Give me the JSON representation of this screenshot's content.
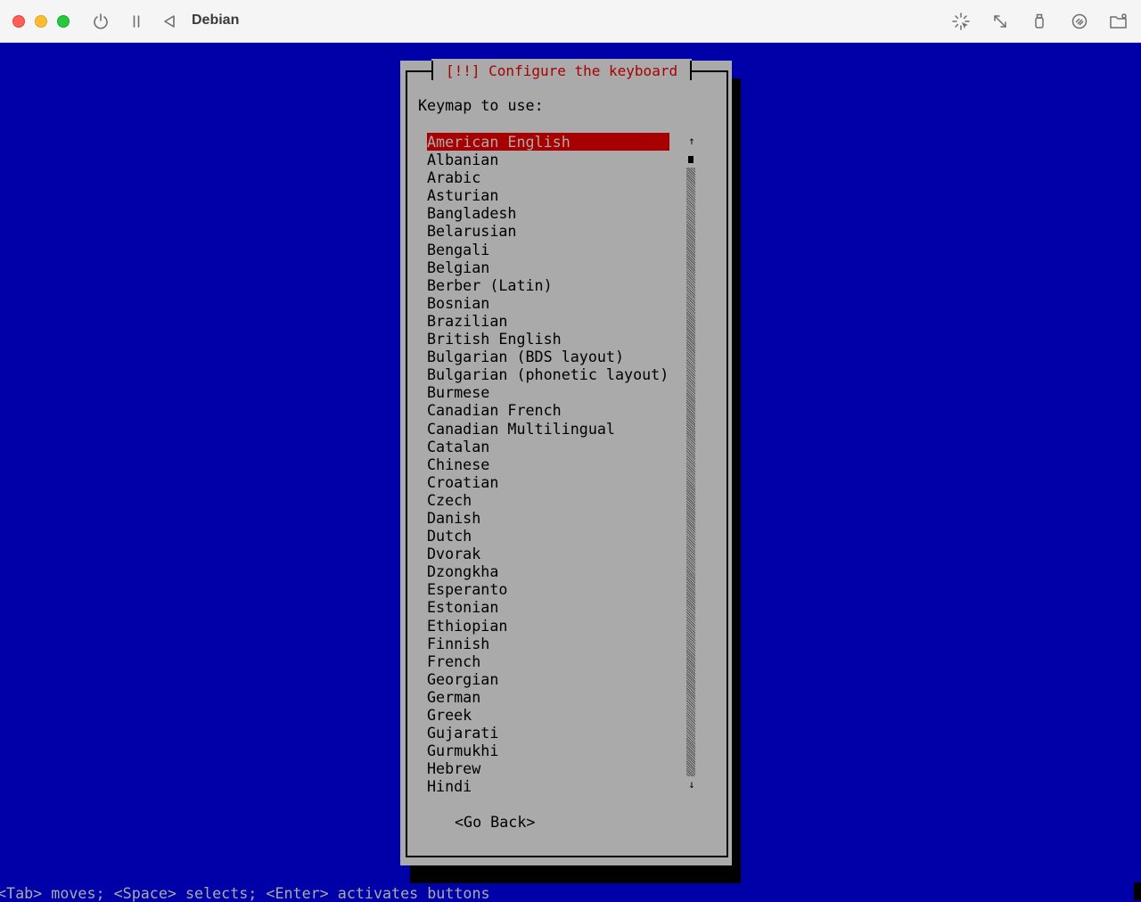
{
  "window": {
    "title": "Debian"
  },
  "dialog": {
    "title": "[!!] Configure the keyboard",
    "prompt": "Keymap to use:",
    "keymaps": [
      "American English",
      "Albanian",
      "Arabic",
      "Asturian",
      "Bangladesh",
      "Belarusian",
      "Bengali",
      "Belgian",
      "Berber (Latin)",
      "Bosnian",
      "Brazilian",
      "British English",
      "Bulgarian (BDS layout)",
      "Bulgarian (phonetic layout)",
      "Burmese",
      "Canadian French",
      "Canadian Multilingual",
      "Catalan",
      "Chinese",
      "Croatian",
      "Czech",
      "Danish",
      "Dutch",
      "Dvorak",
      "Dzongkha",
      "Esperanto",
      "Estonian",
      "Ethiopian",
      "Finnish",
      "French",
      "Georgian",
      "German",
      "Greek",
      "Gujarati",
      "Gurmukhi",
      "Hebrew",
      "Hindi"
    ],
    "selected_index": 0,
    "go_back": "<Go Back>",
    "scroll_up_arrow": "↑",
    "scroll_down_arrow": "↓"
  },
  "status_bar": "<Tab> moves; <Space> selects; <Enter> activates buttons",
  "colors": {
    "background_blue": "#0000a8",
    "dialog_gray": "#aaaaaa",
    "highlight_red": "#a80000"
  }
}
